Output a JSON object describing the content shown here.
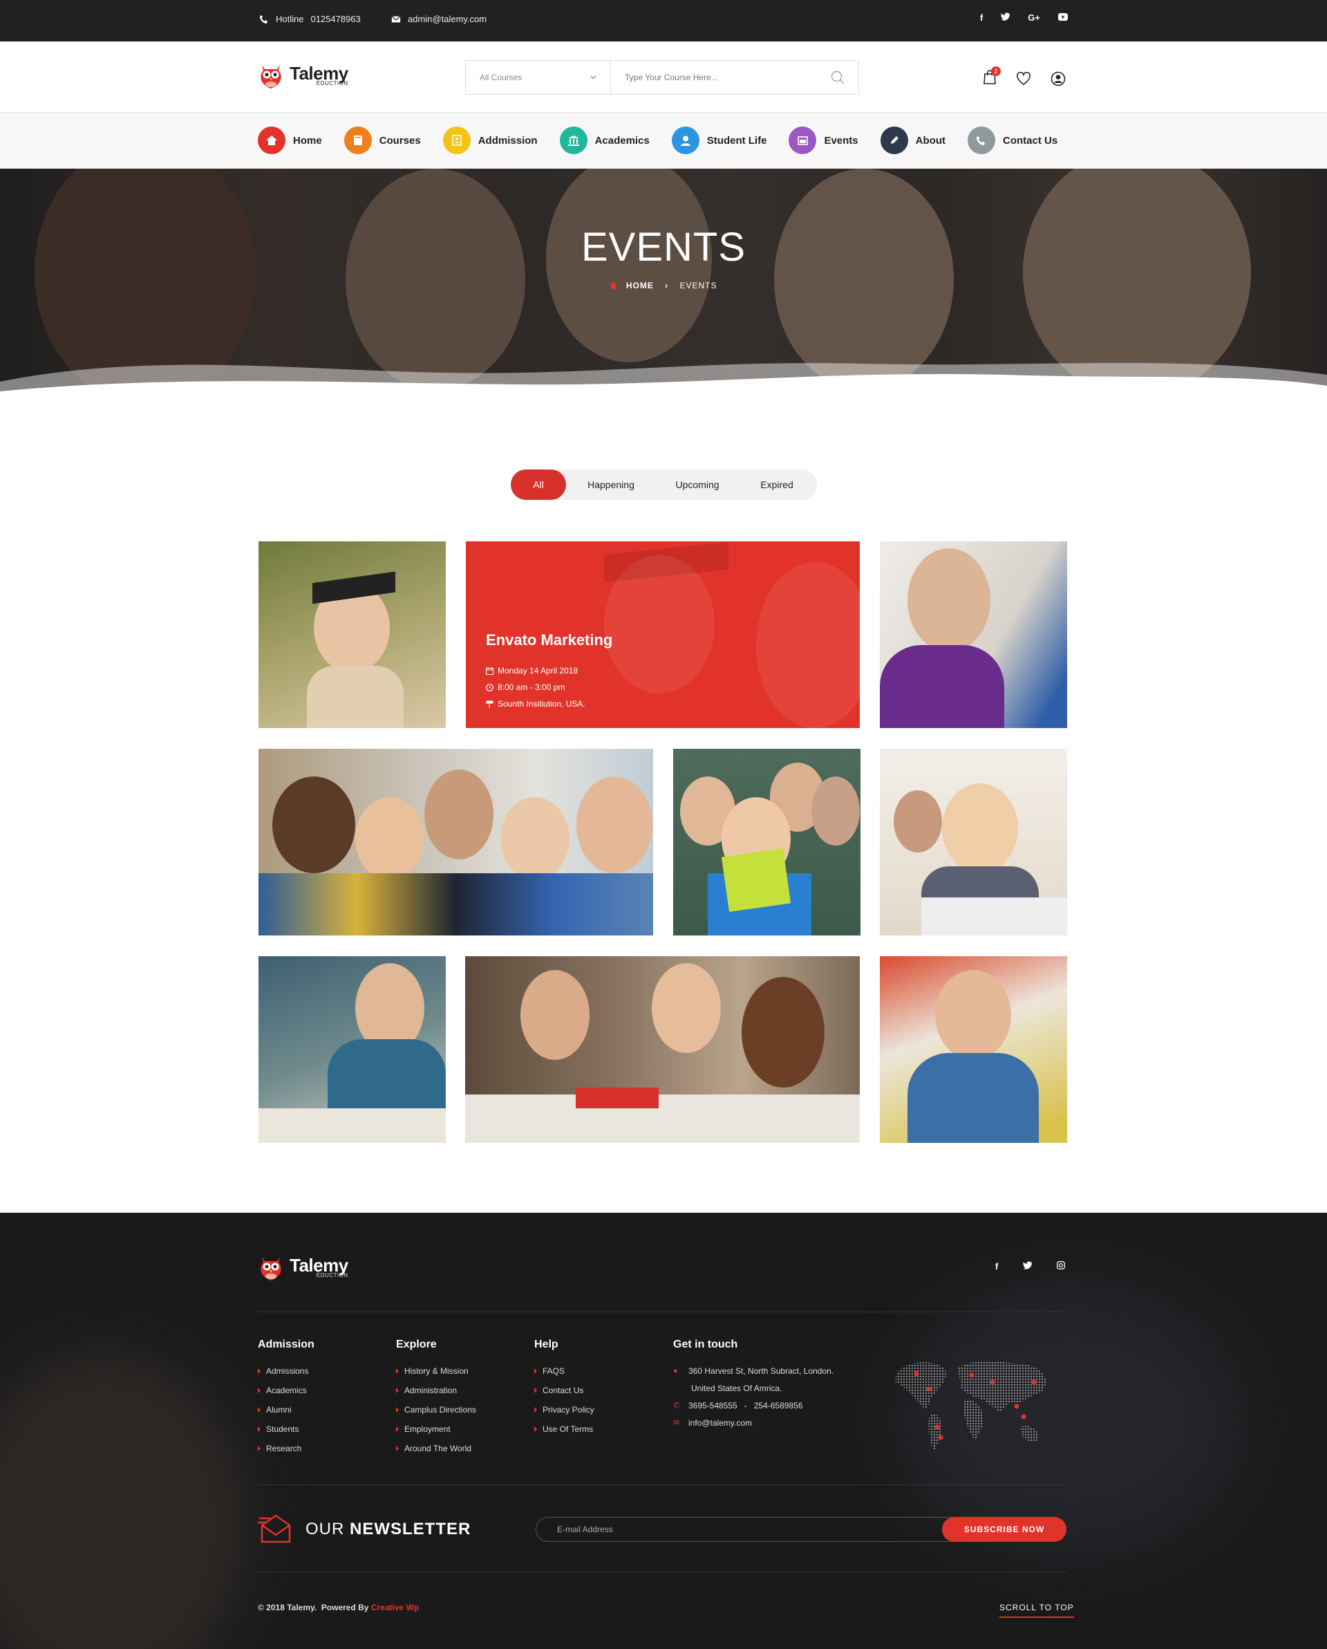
{
  "topbar": {
    "hotline_label": "Hotline",
    "hotline_number": "0125478963",
    "email": "admin@talemy.com",
    "social": [
      "f",
      "t",
      "G+",
      "yt"
    ]
  },
  "brand": {
    "name": "Talemy",
    "tagline": "EDUCTION"
  },
  "search": {
    "category": "All Courses",
    "placeholder": "Type Your Course Here..."
  },
  "header_icons": {
    "cart_count": "2"
  },
  "nav": [
    {
      "label": "Home",
      "color": "#e2332a",
      "icon": "home-icon"
    },
    {
      "label": "Courses",
      "color": "#ee7f1b",
      "icon": "book-icon"
    },
    {
      "label": "Addmission",
      "color": "#f3c414",
      "icon": "form-icon"
    },
    {
      "label": "Academics",
      "color": "#1fb89a",
      "icon": "bank-icon"
    },
    {
      "label": "Student Life",
      "color": "#2b96e0",
      "icon": "user-icon"
    },
    {
      "label": "Events",
      "color": "#9b57c4",
      "icon": "calendar-icon"
    },
    {
      "label": "About",
      "color": "#2d3a4b",
      "icon": "pen-icon"
    },
    {
      "label": "Contact Us",
      "color": "#8f9a9c",
      "icon": "phone-icon"
    }
  ],
  "hero": {
    "title": "EVENTS",
    "breadcrumb_home": "HOME",
    "breadcrumb_current": "EVENTS"
  },
  "filters": [
    "All",
    "Happening",
    "Upcoming",
    "Expired"
  ],
  "active_filter": "All",
  "featured_event": {
    "title": "Envato Marketing",
    "date": "Monday 14 April 2018",
    "time": "8:00 am - 3:00 pm",
    "location": "Sounth Insitiution, USA."
  },
  "footer": {
    "columns": [
      {
        "title": "Admission",
        "items": [
          "Admissions",
          "Academics",
          "Alumni",
          "Students",
          "Research"
        ]
      },
      {
        "title": "Explore",
        "items": [
          "History & Mission",
          "Administration",
          "Camplus Directions",
          "Employment",
          "Around The World"
        ]
      },
      {
        "title": "Help",
        "items": [
          "FAQS",
          "Contact Us",
          "Privacy Policy",
          "Use Of Terms"
        ]
      }
    ],
    "contact": {
      "title": "Get in touch",
      "address_line1": "360 Harvest St, North Subract, London.",
      "address_line2": "United States Of Amrica.",
      "phone": "3695-548555   -   254-6589856",
      "email": "info@talemy.com"
    },
    "newsletter": {
      "title_light": "OUR ",
      "title_bold": "NEWSLETTER",
      "placeholder": "E-mail Address",
      "button": "SUBSCRIBE NOW"
    },
    "copyright": "© 2018 Talemy.  Powered By ",
    "powered_by": "Creative Wp",
    "scroll_top": "SCROLL TO TOP",
    "social": [
      "f",
      "t",
      "ig"
    ]
  },
  "colors": {
    "accent": "#e2332a",
    "topbar": "#212121",
    "footer": "#1a1a1a"
  }
}
